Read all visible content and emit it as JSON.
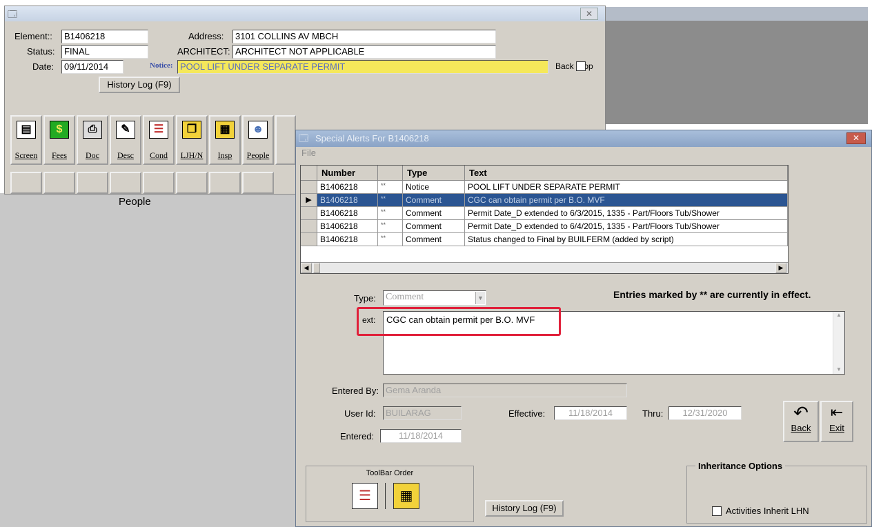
{
  "main_window": {
    "labels": {
      "element": "Element::",
      "status": "Status:",
      "date": "Date:",
      "address": "Address:",
      "architect": "ARCHITECT:",
      "notice": "Notice:",
      "back_stop": "Back Stop"
    },
    "values": {
      "element": "B1406218",
      "status": "FINAL",
      "date": "09/11/2014",
      "address": "3101 COLLINS AV  MBCH",
      "architect": "ARCHITECT NOT APPLICABLE",
      "notice": "POOL LIFT UNDER SEPARATE PERMIT"
    },
    "history_button": "History Log (F9)",
    "toolbar": [
      {
        "label": "Screen",
        "icon": "screen-icon",
        "glyph": "▤",
        "color": "#ffffff"
      },
      {
        "label": "Fees",
        "icon": "fees-icon",
        "glyph": "$",
        "color": "#22aa22"
      },
      {
        "label": "Doc",
        "icon": "printer-icon",
        "glyph": "⎙",
        "color": "#dddddd"
      },
      {
        "label": "Desc",
        "icon": "pencil-icon",
        "glyph": "✎",
        "color": "#ffffff"
      },
      {
        "label": "Cond",
        "icon": "checklist-icon",
        "glyph": "☰",
        "color": "#ffffff"
      },
      {
        "label": "LJH/N",
        "icon": "folder-icon",
        "glyph": "❐",
        "color": "#f2d23a"
      },
      {
        "label": "Insp",
        "icon": "clipboard-icon",
        "glyph": "▦",
        "color": "#f2d23a"
      },
      {
        "label": "People",
        "icon": "people-icon",
        "glyph": "☻",
        "color": "#4a72b8"
      }
    ],
    "tab_caption": "People"
  },
  "alert_window": {
    "title": "Special Alerts For B1406218",
    "menu_file": "File",
    "grid": {
      "headers": [
        "Number",
        "",
        "Type",
        "Text"
      ],
      "rows": [
        {
          "number": "B1406218",
          "flag": "**",
          "type": "Notice",
          "text": "POOL LIFT UNDER SEPARATE PERMIT"
        },
        {
          "number": "B1406218",
          "flag": "**",
          "type": "Comment",
          "text": "CGC can obtain permit per B.O. MVF"
        },
        {
          "number": "B1406218",
          "flag": "**",
          "type": "Comment",
          "text": "Permit Date_D extended to 6/3/2015, 1335 - Part/Floors Tub/Shower"
        },
        {
          "number": "B1406218",
          "flag": "**",
          "type": "Comment",
          "text": "Permit Date_D extended to 6/4/2015, 1335 - Part/Floors Tub/Shower"
        },
        {
          "number": "B1406218",
          "flag": "**",
          "type": "Comment",
          "text": "Status changed to Final by BUILFERM (added by script)"
        }
      ]
    },
    "type_label": "Type:",
    "type_value": "Comment",
    "entries_note": "Entries marked by ** are currently in effect.",
    "text_label": "ext:",
    "text_value": "CGC can obtain permit per B.O. MVF",
    "entered_by_label": "Entered By:",
    "entered_by_value": "Gema Aranda",
    "user_id_label": "User Id:",
    "user_id_value": "BUILARAG",
    "effective_label": "Effective:",
    "effective_value": "11/18/2014",
    "thru_label": "Thru:",
    "thru_value": "12/31/2020",
    "entered_label": "Entered:",
    "entered_value": "11/18/2014",
    "back_button": "Back",
    "exit_button": "Exit",
    "toolbar_order_label": "ToolBar Order",
    "history_button": "History Log (F9)",
    "inheritance_title": "Inheritance Options",
    "activities_inherit": "Activities Inherit LHN"
  },
  "colors": {
    "selection": "#2b5592",
    "notice_bg": "#f5e85a",
    "highlight": "#e0203a"
  }
}
